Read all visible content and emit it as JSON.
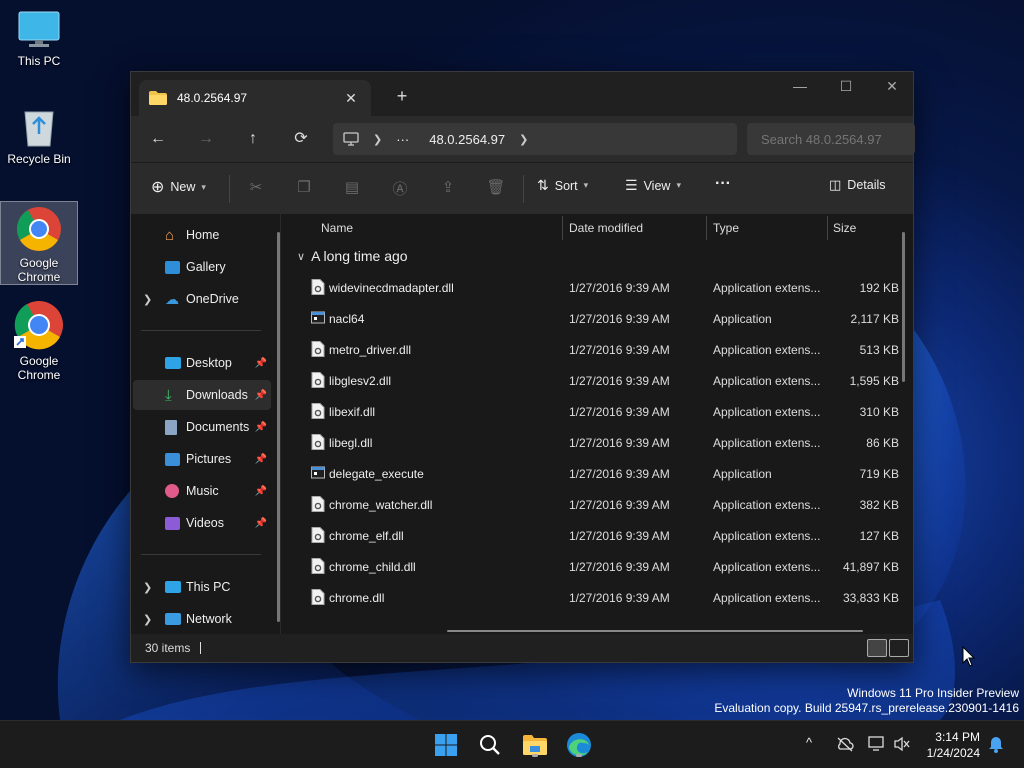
{
  "desktop": {
    "icons": [
      {
        "label": "This PC"
      },
      {
        "label": "Recycle Bin"
      },
      {
        "label": "Google Chrome"
      },
      {
        "label": "Google Chrome"
      }
    ]
  },
  "window": {
    "tab_title": "48.0.2564.97",
    "tab_close": "✕",
    "new_tab": "+",
    "controls": {
      "minimize": "—",
      "maximize": "☐",
      "close": "✕"
    },
    "nav": {
      "back": "←",
      "forward": "→",
      "up": "↑",
      "refresh": "⟳"
    },
    "address": {
      "more": "···",
      "folder": "48.0.2564.97"
    },
    "search_placeholder": "Search 48.0.2564.97",
    "commands": {
      "new": "New",
      "sort": "Sort",
      "view": "View",
      "more": "···",
      "details": "Details"
    },
    "navpane": {
      "home": "Home",
      "gallery": "Gallery",
      "onedrive": "OneDrive",
      "desktop": "Desktop",
      "downloads": "Downloads",
      "documents": "Documents",
      "pictures": "Pictures",
      "music": "Music",
      "videos": "Videos",
      "thispc": "This PC",
      "network": "Network"
    },
    "columns": {
      "name": "Name",
      "date": "Date modified",
      "type": "Type",
      "size": "Size"
    },
    "group": "A long time ago",
    "files": [
      {
        "name": "widevinecdmadapter.dll",
        "date": "1/27/2016 9:39 AM",
        "type": "Application extens...",
        "size": "192 KB",
        "kind": "dll"
      },
      {
        "name": "nacl64",
        "date": "1/27/2016 9:39 AM",
        "type": "Application",
        "size": "2,117 KB",
        "kind": "exe"
      },
      {
        "name": "metro_driver.dll",
        "date": "1/27/2016 9:39 AM",
        "type": "Application extens...",
        "size": "513 KB",
        "kind": "dll"
      },
      {
        "name": "libglesv2.dll",
        "date": "1/27/2016 9:39 AM",
        "type": "Application extens...",
        "size": "1,595 KB",
        "kind": "dll"
      },
      {
        "name": "libexif.dll",
        "date": "1/27/2016 9:39 AM",
        "type": "Application extens...",
        "size": "310 KB",
        "kind": "dll"
      },
      {
        "name": "libegl.dll",
        "date": "1/27/2016 9:39 AM",
        "type": "Application extens...",
        "size": "86 KB",
        "kind": "dll"
      },
      {
        "name": "delegate_execute",
        "date": "1/27/2016 9:39 AM",
        "type": "Application",
        "size": "719 KB",
        "kind": "exe"
      },
      {
        "name": "chrome_watcher.dll",
        "date": "1/27/2016 9:39 AM",
        "type": "Application extens...",
        "size": "382 KB",
        "kind": "dll"
      },
      {
        "name": "chrome_elf.dll",
        "date": "1/27/2016 9:39 AM",
        "type": "Application extens...",
        "size": "127 KB",
        "kind": "dll"
      },
      {
        "name": "chrome_child.dll",
        "date": "1/27/2016 9:39 AM",
        "type": "Application extens...",
        "size": "41,897 KB",
        "kind": "dll"
      },
      {
        "name": "chrome.dll",
        "date": "1/27/2016 9:39 AM",
        "type": "Application extens...",
        "size": "33,833 KB",
        "kind": "dll"
      }
    ],
    "status": "30 items"
  },
  "watermark": {
    "line1": "Windows 11 Pro Insider Preview",
    "line2": "Evaluation copy. Build 25947.rs_prerelease.230901-1416"
  },
  "taskbar": {
    "tray_chevron": "^",
    "time": "3:14 PM",
    "date": "1/24/2024"
  },
  "colors": {
    "accent": "#0078d4",
    "folder": "#f3c24a"
  }
}
